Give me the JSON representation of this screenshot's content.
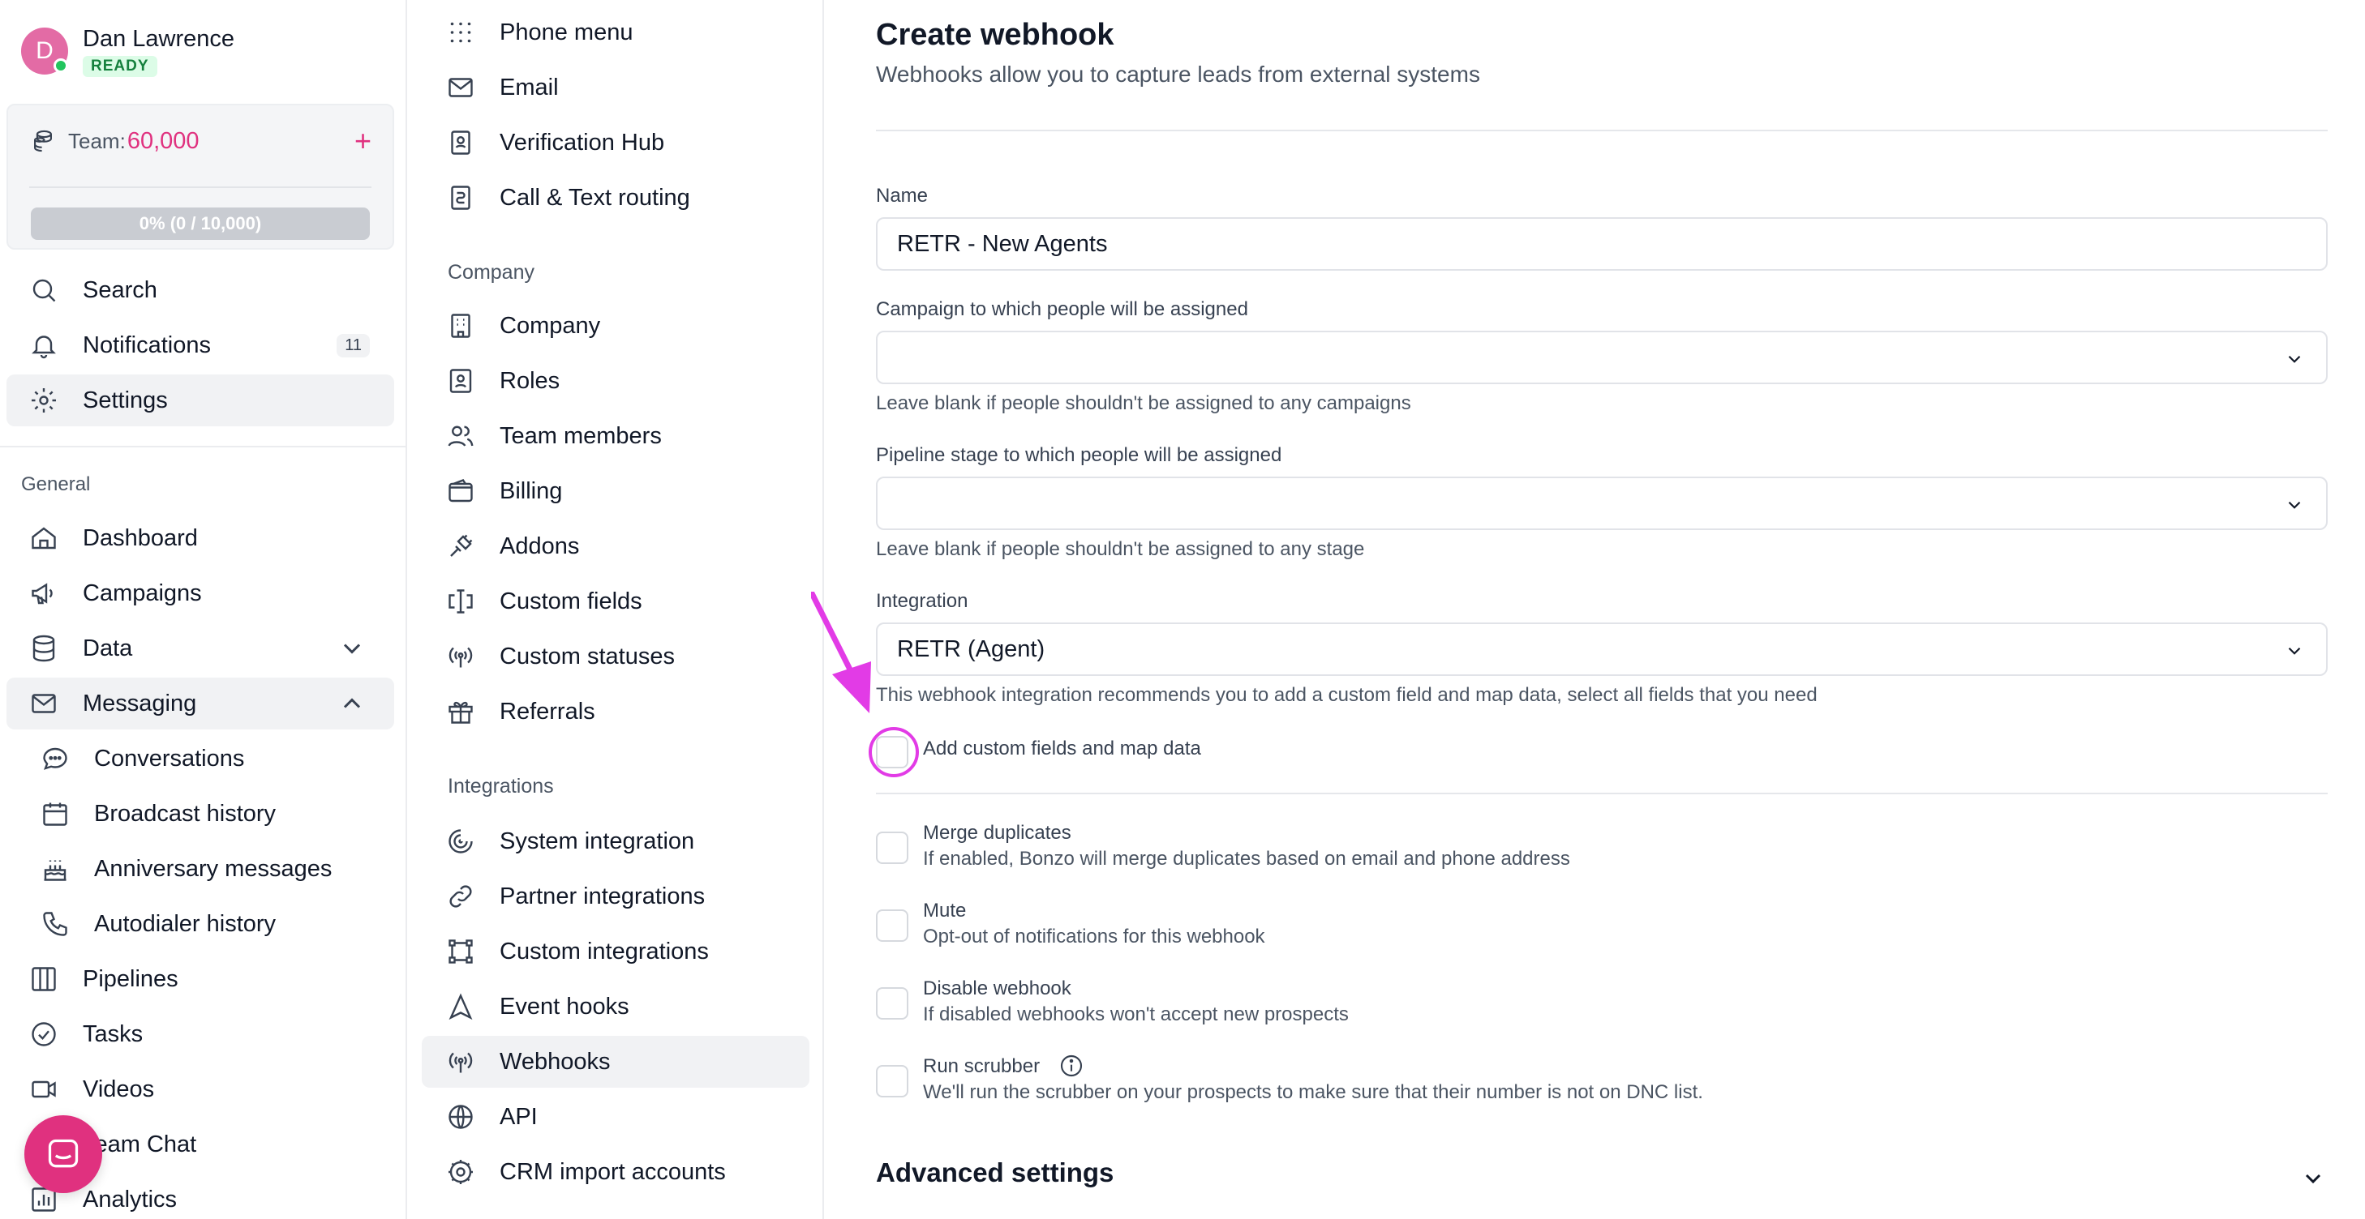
{
  "user": {
    "initial": "D",
    "name": "Dan Lawrence",
    "status": "READY"
  },
  "team": {
    "label": "Team:",
    "credits": "60,000",
    "add_symbol": "+",
    "progress_text": "0% (0 / 10,000)",
    "progress_fraction": 0
  },
  "top_nav": [
    {
      "label": "Search",
      "icon": "search-icon"
    },
    {
      "label": "Notifications",
      "icon": "bell-icon",
      "badge": "11"
    },
    {
      "label": "Settings",
      "icon": "gear-icon",
      "active": true
    }
  ],
  "general": {
    "heading": "General",
    "items": [
      {
        "label": "Dashboard",
        "icon": "home-icon"
      },
      {
        "label": "Campaigns",
        "icon": "megaphone-icon"
      },
      {
        "label": "Data",
        "icon": "database-icon",
        "chevron": "down"
      },
      {
        "label": "Messaging",
        "icon": "mail-icon",
        "chevron": "up",
        "active": true
      },
      {
        "label": "Conversations",
        "icon": "chat-bubble-icon",
        "sub": true
      },
      {
        "label": "Broadcast history",
        "icon": "calendar-icon",
        "sub": true
      },
      {
        "label": "Anniversary messages",
        "icon": "cake-icon",
        "sub": true
      },
      {
        "label": "Autodialer history",
        "icon": "phone-icon",
        "sub": true
      },
      {
        "label": "Pipelines",
        "icon": "columns-icon"
      },
      {
        "label": "Tasks",
        "icon": "check-circle-icon"
      },
      {
        "label": "Videos",
        "icon": "video-icon"
      },
      {
        "label": "Team Chat",
        "icon": "team-chat-icon"
      },
      {
        "label": "Analytics",
        "icon": "analytics-icon"
      }
    ]
  },
  "settings_nav": {
    "top_items": [
      {
        "label": "Phone menu",
        "icon": "dial-pad-icon"
      },
      {
        "label": "Email",
        "icon": "envelope-icon"
      },
      {
        "label": "Verification Hub",
        "icon": "badge-icon"
      },
      {
        "label": "Call & Text routing",
        "icon": "routing-icon"
      }
    ],
    "company_heading": "Company",
    "company_items": [
      {
        "label": "Company",
        "icon": "building-icon"
      },
      {
        "label": "Roles",
        "icon": "id-card-icon"
      },
      {
        "label": "Team members",
        "icon": "users-icon"
      },
      {
        "label": "Billing",
        "icon": "wallet-icon"
      },
      {
        "label": "Addons",
        "icon": "plug-icon"
      },
      {
        "label": "Custom fields",
        "icon": "text-cursor-icon"
      },
      {
        "label": "Custom statuses",
        "icon": "broadcast-icon"
      },
      {
        "label": "Referrals",
        "icon": "gift-icon"
      }
    ],
    "integrations_heading": "Integrations",
    "integration_items": [
      {
        "label": "System integration",
        "icon": "swirl-icon"
      },
      {
        "label": "Partner integrations",
        "icon": "link-icon"
      },
      {
        "label": "Custom integrations",
        "icon": "vector-square-icon"
      },
      {
        "label": "Event hooks",
        "icon": "navigation-icon"
      },
      {
        "label": "Webhooks",
        "icon": "signal-icon",
        "active": true
      },
      {
        "label": "API",
        "icon": "globe-icon"
      },
      {
        "label": "CRM import accounts",
        "icon": "cog-icon"
      }
    ]
  },
  "form": {
    "title": "Create webhook",
    "subtitle": "Webhooks allow you to capture leads from external systems",
    "name_label": "Name",
    "name_value": "RETR - New Agents",
    "campaign_label": "Campaign to which people will be assigned",
    "campaign_value": "",
    "campaign_help": "Leave blank if people shouldn't be assigned to any campaigns",
    "pipeline_label": "Pipeline stage to which people will be assigned",
    "pipeline_value": "",
    "pipeline_help": "Leave blank if people shouldn't be assigned to any stage",
    "integration_label": "Integration",
    "integration_value": "RETR (Agent)",
    "integration_help": "This webhook integration recommends you to add a custom field and map data, select all fields that you need",
    "custom_fields_label": "Add custom fields and map data",
    "options": [
      {
        "title": "Merge duplicates",
        "desc": "If enabled, Bonzo will merge duplicates based on email and phone address"
      },
      {
        "title": "Mute",
        "desc": "Opt-out of notifications for this webhook"
      },
      {
        "title": "Disable webhook",
        "desc": "If disabled webhooks won't accept new prospects"
      },
      {
        "title": "Run scrubber",
        "desc": "We'll run the scrubber on your prospects to make sure that their number is not on DNC list.",
        "info": true
      }
    ],
    "advanced_label": "Advanced settings"
  },
  "colors": {
    "accent": "#e0317f",
    "annotation": "#e23be6",
    "ready": "#15803d"
  }
}
